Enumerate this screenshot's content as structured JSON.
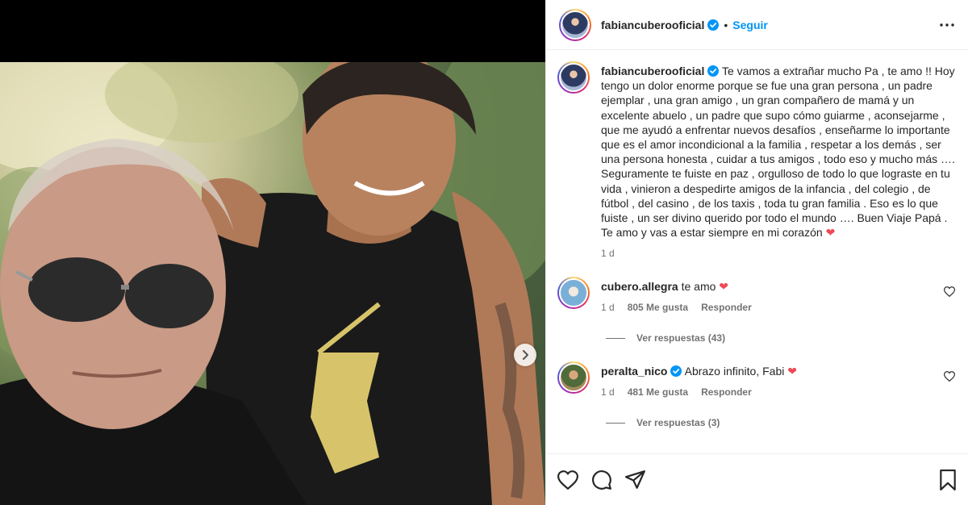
{
  "post": {
    "username": "fabiancuberooficial",
    "follow_label": "Seguir",
    "separator": "•"
  },
  "caption": {
    "username": "fabiancuberooficial",
    "text": "Te vamos a extrañar mucho Pa , te amo !! Hoy tengo un dolor enorme porque se fue una gran persona , un padre ejemplar , una gran amigo , un gran compañero de mamá y un excelente abuelo , un padre que supo cómo guiarme , aconsejarme , que me ayudó a enfrentar nuevos desafíos , enseñarme lo importante que es el amor incondicional a la familia , respetar a los demás , ser una persona honesta , cuidar a tus amigos , todo eso y mucho más …. Seguramente te fuiste en paz , orgulloso de todo lo que lograste en tu vida , vinieron a despedirte amigos de la infancia , del colegio , de fútbol , del casino , de los taxis , toda tu gran familia . Eso es lo que fuiste , un ser divino querido por todo el mundo …. Buen Viaje Papá . Te amo y vas a estar siempre en mi corazón",
    "emoji": "❤",
    "time": "1 d"
  },
  "comments": [
    {
      "username": "cubero.allegra",
      "text": "te amo",
      "emoji": "❤",
      "time": "1 d",
      "likes": "805 Me gusta",
      "reply_label": "Responder",
      "view_replies": "Ver respuestas (43)"
    },
    {
      "username": "peralta_nico",
      "text": "Abrazo infinito, Fabi",
      "emoji": "❤",
      "time": "1 d",
      "likes": "481 Me gusta",
      "reply_label": "Responder",
      "view_replies": "Ver respuestas (3)"
    }
  ],
  "colors": {
    "accent": "#0095f6",
    "verified": "#0095f6",
    "heart": "#ed4956",
    "text": "#262626",
    "muted": "#737373"
  },
  "icons": [
    "verified-badge-icon",
    "more-options-icon",
    "heart-icon",
    "comment-icon",
    "share-icon",
    "bookmark-icon",
    "chevron-right-icon"
  ]
}
